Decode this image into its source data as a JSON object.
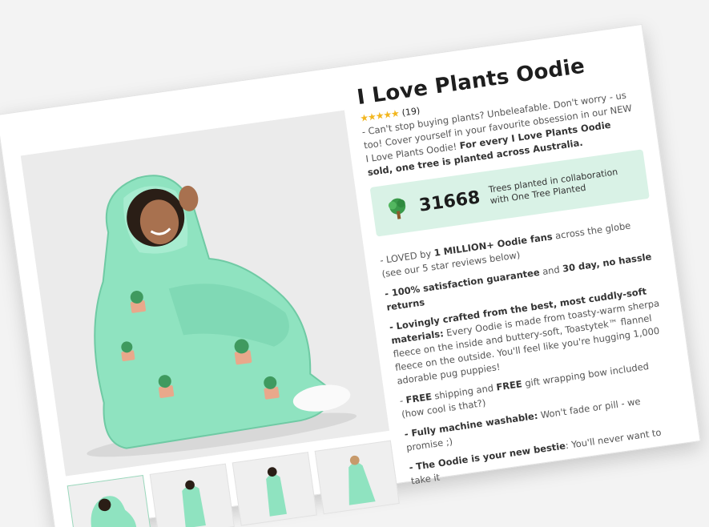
{
  "product": {
    "title": "I Love Plants Oodie",
    "stars": "★★★★★",
    "review_count": "(19)",
    "desc_part1": "- Can't stop buying plants? Unbeleafable. Don't worry - us too! Cover yourself in your favourite obsession in our NEW I Love Plants Oodie!",
    "desc_bold": "For every I Love Plants Oodie sold, one tree is planted across Australia."
  },
  "trees": {
    "count": "31668",
    "line1": "Trees planted in collaboration",
    "line2": "with One Tree Planted"
  },
  "bullets": {
    "b1_pre": "- LOVED by ",
    "b1_bold": "1 MILLION+ Oodie fans",
    "b1_post": " across the globe (see our 5 star reviews below)",
    "b2_bold1": "- 100% satisfaction guarantee",
    "b2_mid": " and ",
    "b2_bold2": "30 day, no hassle returns",
    "b3_bold": "- Lovingly crafted from the best, most cuddly-soft materials:",
    "b3_text": " Every Oodie is made from toasty-warm sherpa fleece on the inside and buttery-soft, Toastytek™ flannel fleece on the outside. You'll feel like you're hugging 1,000 adorable pug puppies!",
    "b4_pre": "- ",
    "b4_bold1": "FREE",
    "b4_mid": " shipping and ",
    "b4_bold2": "FREE",
    "b4_post": " gift wrapping bow included (how cool is that?)",
    "b5_bold": "- Fully machine washable:",
    "b5_text": " Won't fade or pill - we promise ;)",
    "b6_bold": "- The Oodie is your new bestie",
    "b6_text": ": You'll never want to take it"
  },
  "colors": {
    "oodie": "#8fe3c0",
    "tree_box": "#d9f2e6",
    "stars": "#f2b61f"
  }
}
